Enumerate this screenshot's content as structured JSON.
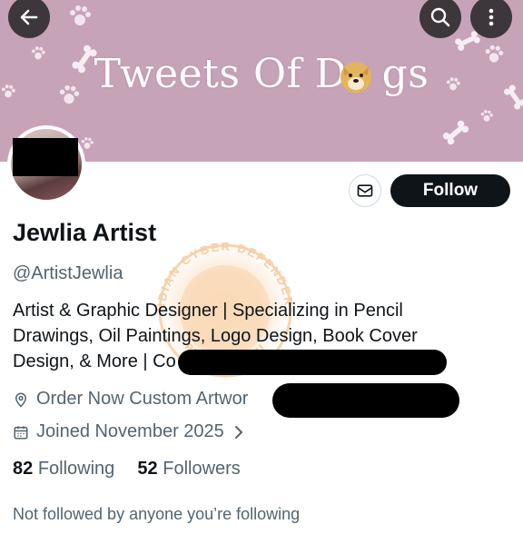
{
  "banner": {
    "title": "Tweets Of Dgs",
    "title_prefix": "Tweets Of D",
    "title_suffix": "gs",
    "background_color": "#c7a3b7"
  },
  "header_buttons": {
    "back_icon": "arrow-left-icon",
    "search_icon": "search-icon",
    "more_icon": "more-vertical-icon"
  },
  "profile": {
    "name": "Jewlia Artist",
    "handle": "@ArtistJewlia",
    "bio_lines": [
      "Artist & Graphic Designer | Specializing in Pencil",
      "Drawings, Oil Paintings, Logo Design, Book Cover",
      "Design, & More | Co"
    ],
    "location_text": "Order Now Custom Artwor",
    "joined_text": "Joined November 2025",
    "following_count": "82",
    "following_label": "Following",
    "followers_count": "52",
    "followers_label": "Followers",
    "not_followed_text": "Not followed by anyone you’re following"
  },
  "actions": {
    "message_icon": "mail-icon",
    "follow_label": "Follow"
  },
  "icons": {
    "location": "location-pin-icon",
    "calendar": "calendar-icon",
    "chevron": "chevron-right-icon"
  },
  "watermark": {
    "text_top": "INDIAN CYBER DEFENDERS",
    "text_bottom": "PROTECT YOU"
  }
}
